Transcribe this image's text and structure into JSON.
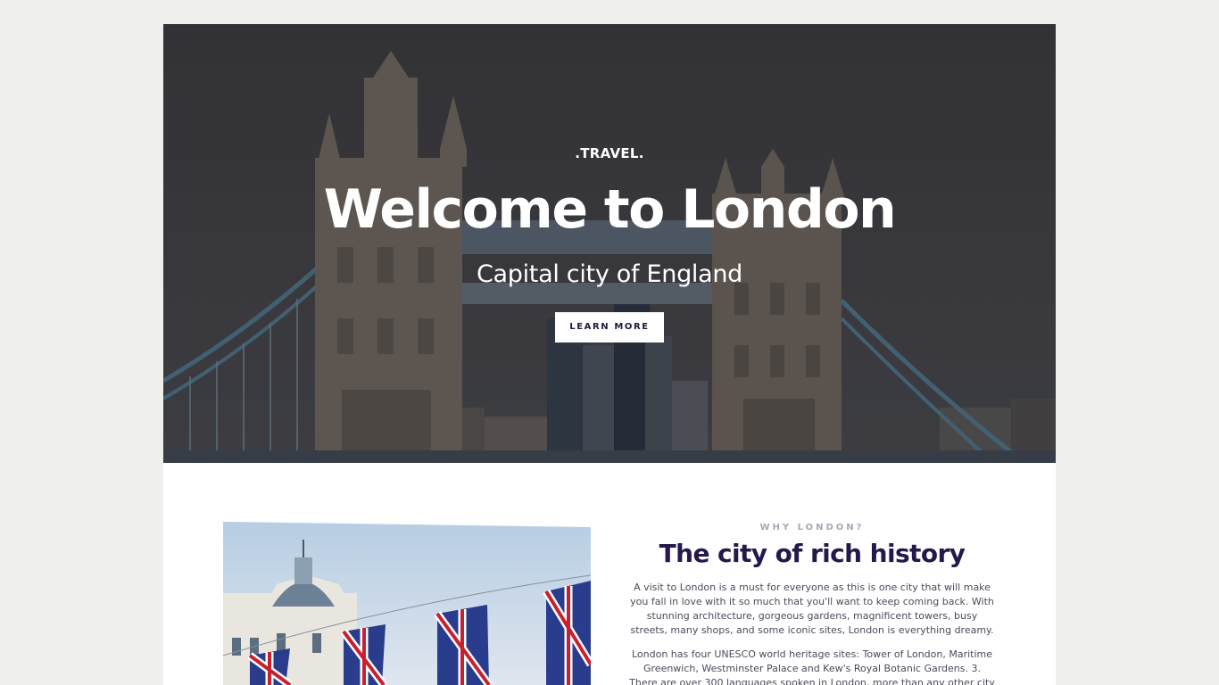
{
  "hero": {
    "brand": ".TRAVEL.",
    "title": "Welcome to London",
    "subtitle": "Capital city of England",
    "button_label": "LEARN MORE"
  },
  "about": {
    "kicker": "WHY LONDON?",
    "title": "The city of rich history",
    "paragraphs": [
      "A visit to London is a must for everyone as this is one city that will make you fall in love with it so much that you'll want to keep coming back. With stunning architecture, gorgeous gardens, magnificent towers, busy streets, many shops, and some iconic sites, London is everything dreamy.",
      "London has four UNESCO world heritage sites: Tower of London, Maritime Greenwich, Westminster Palace and Kew's Royal Botanic Gardens. 3. There are over 300 languages spoken in London, more than any other city in the"
    ]
  },
  "colors": {
    "page_bg": "#eff0ec",
    "title_color": "#26184a",
    "kicker_color": "#a9a7b5"
  },
  "images": {
    "hero": "tower-bridge-photo",
    "section": "union-jack-bunting-photo"
  }
}
